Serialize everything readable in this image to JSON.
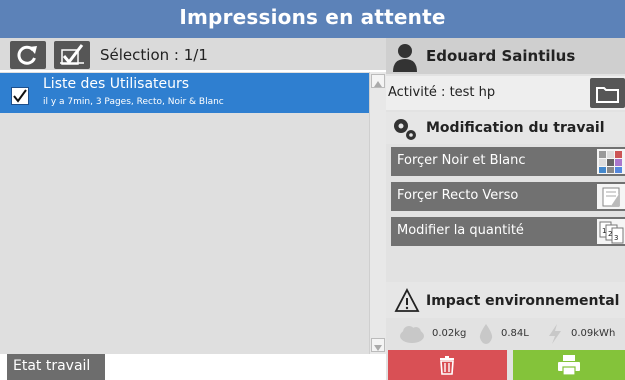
{
  "window": {
    "title": "Impressions en attente"
  },
  "toolbar": {
    "selection_label": "Sélection : 1/1",
    "refresh_icon": "refresh-icon",
    "select_all_icon": "select-all-icon"
  },
  "jobs": [
    {
      "title": "Liste des Utilisateurs",
      "details": "il y a 7min, 3 Pages, Recto, Noir & Blanc",
      "checked": true
    }
  ],
  "footer": {
    "state_button": "Etat travail"
  },
  "user": {
    "name": "Edouard Saintilus",
    "activity": "Activité : test hp"
  },
  "modification": {
    "header": "Modification du travail",
    "actions": [
      {
        "label": "Forçer Noir et Blanc"
      },
      {
        "label": "Forçer Recto Verso"
      },
      {
        "label": "Modifier la quantité"
      }
    ]
  },
  "impact": {
    "header": "Impact environnemental",
    "co2": "0.02kg",
    "water": "0.84L",
    "energy": "0.09kWh"
  },
  "colors": {
    "title_bar": "#5c82b8",
    "selected_row": "#2f7fd0",
    "delete": "#d95055",
    "print": "#84c33a"
  }
}
